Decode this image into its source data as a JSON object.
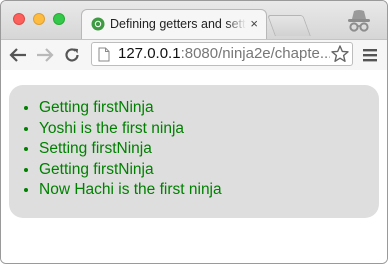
{
  "window": {
    "controls": [
      "close",
      "minimize",
      "maximize"
    ]
  },
  "tab": {
    "title": "Defining getters and setters",
    "favicon": "chrome-favicon-icon",
    "close_label": "×"
  },
  "toolbar": {
    "back_icon": "back-arrow-icon",
    "forward_icon": "forward-arrow-icon",
    "reload_icon": "reload-icon",
    "url_host": "127.0.0.1",
    "url_rest": ":8080/ninja2e/chapte...",
    "bookmark_icon": "star-icon",
    "menu_icon": "hamburger-menu-icon"
  },
  "page": {
    "log": [
      "Getting firstNinja",
      "Yoshi is the first ninja",
      "Setting firstNinja",
      "Getting firstNinja",
      "Now Hachi is the first ninja"
    ]
  },
  "colors": {
    "log_text": "#008000",
    "panel_bg": "#dedede"
  }
}
